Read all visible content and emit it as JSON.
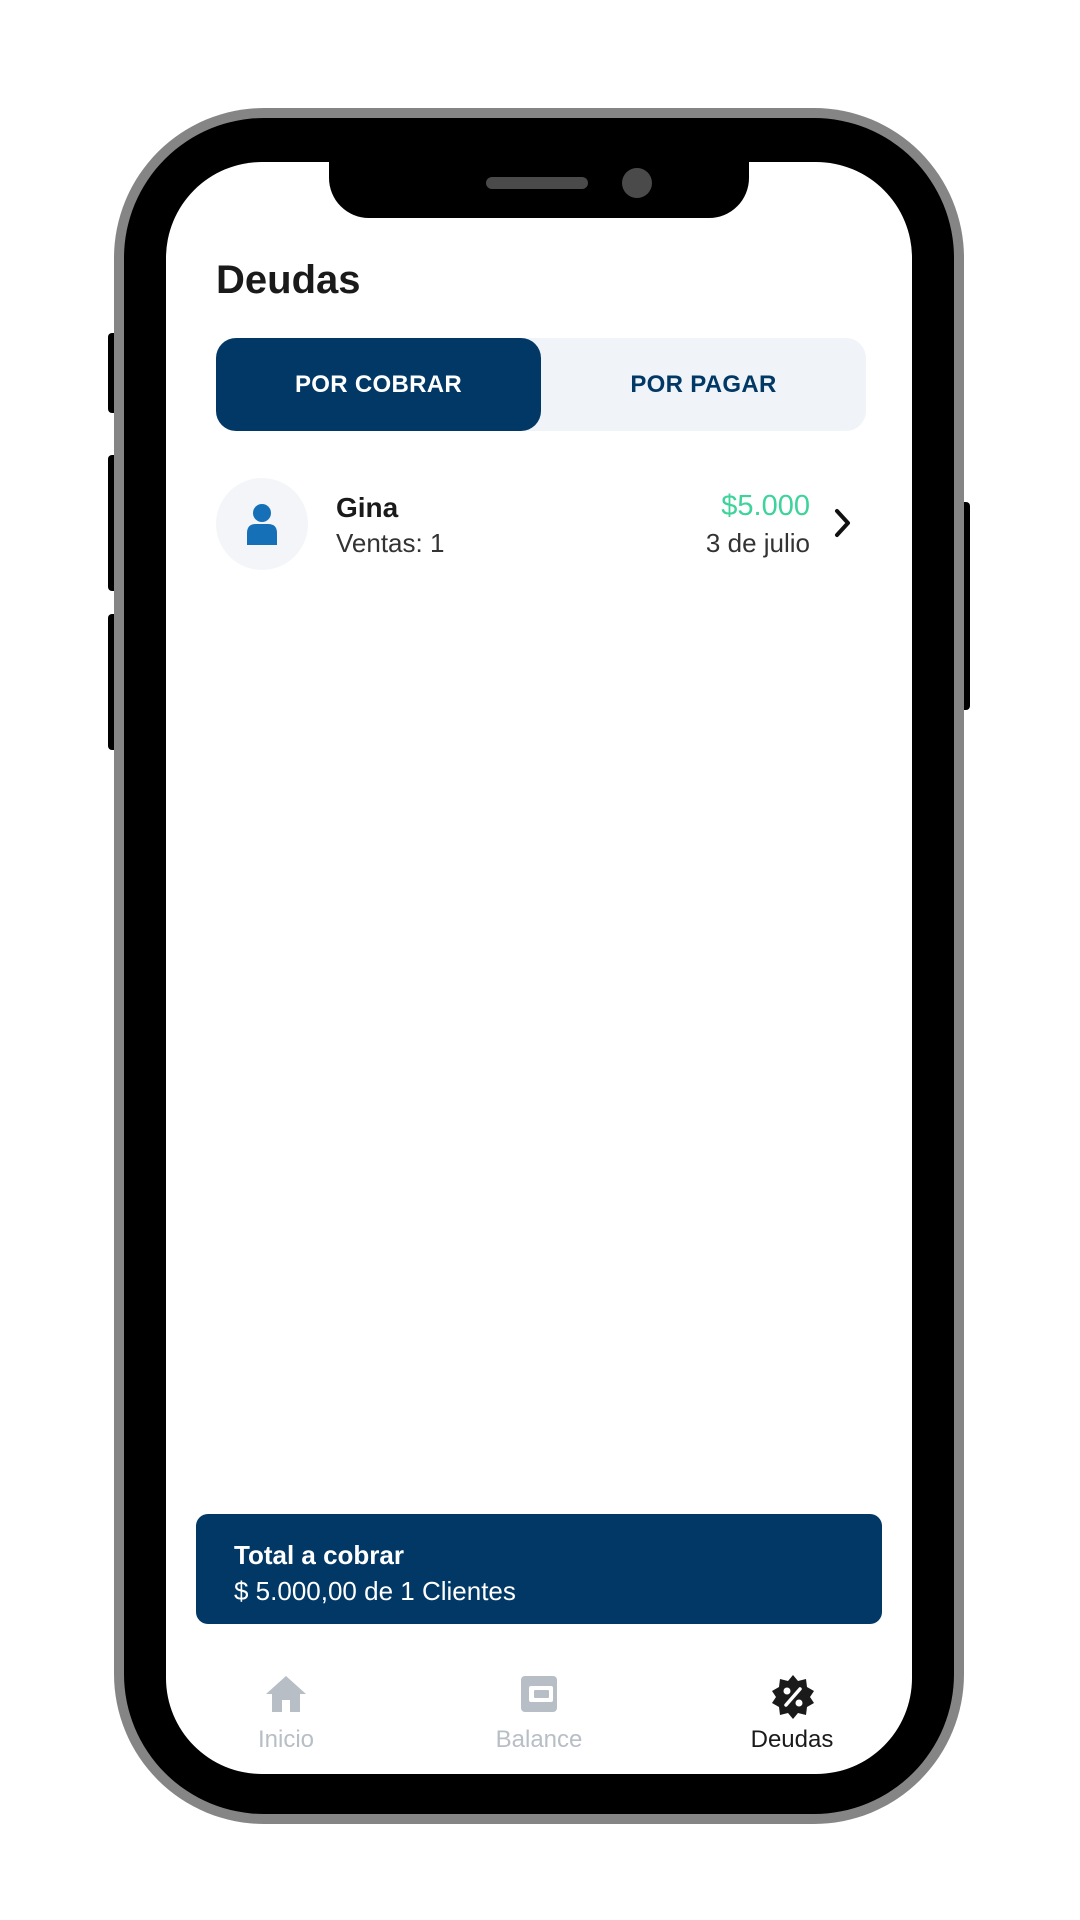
{
  "screen": {
    "title": "Deudas"
  },
  "tabs": {
    "active_label": "POR COBRAR",
    "inactive_label": "POR PAGAR"
  },
  "debts": [
    {
      "name": "Gina",
      "sales": "Ventas: 1",
      "amount": "$5.000",
      "date": "3 de julio"
    }
  ],
  "total": {
    "label": "Total a cobrar",
    "value": "$ 5.000,00 de 1 Clientes"
  },
  "bottom_nav": {
    "items": [
      {
        "label": "Inicio",
        "icon": "home-icon",
        "active": false
      },
      {
        "label": "Balance",
        "icon": "wallet-icon",
        "active": false
      },
      {
        "label": "Deudas",
        "icon": "discount-badge-icon",
        "active": true
      }
    ]
  },
  "colors": {
    "primary": "#023866",
    "amount_green": "#3dd39a",
    "avatar_blue": "#1570b8",
    "inactive_nav": "#b8bec6"
  }
}
